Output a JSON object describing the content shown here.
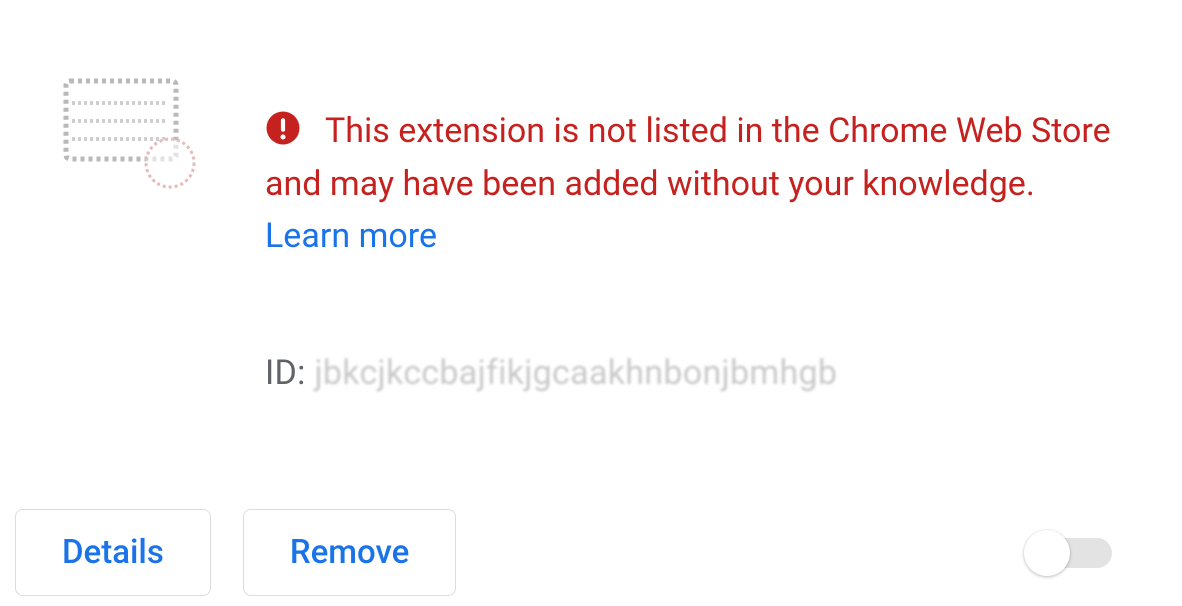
{
  "warning": {
    "text_before": "This extension is not listed in the Chrome Web Store and may have been added without your knowledge. ",
    "learn_more_label": "Learn more"
  },
  "id": {
    "label": "ID: ",
    "value": "jbkcjkccbajfikjgcaakhnbonjbmhgb"
  },
  "buttons": {
    "details": "Details",
    "remove": "Remove"
  },
  "toggle": {
    "state": "off"
  }
}
